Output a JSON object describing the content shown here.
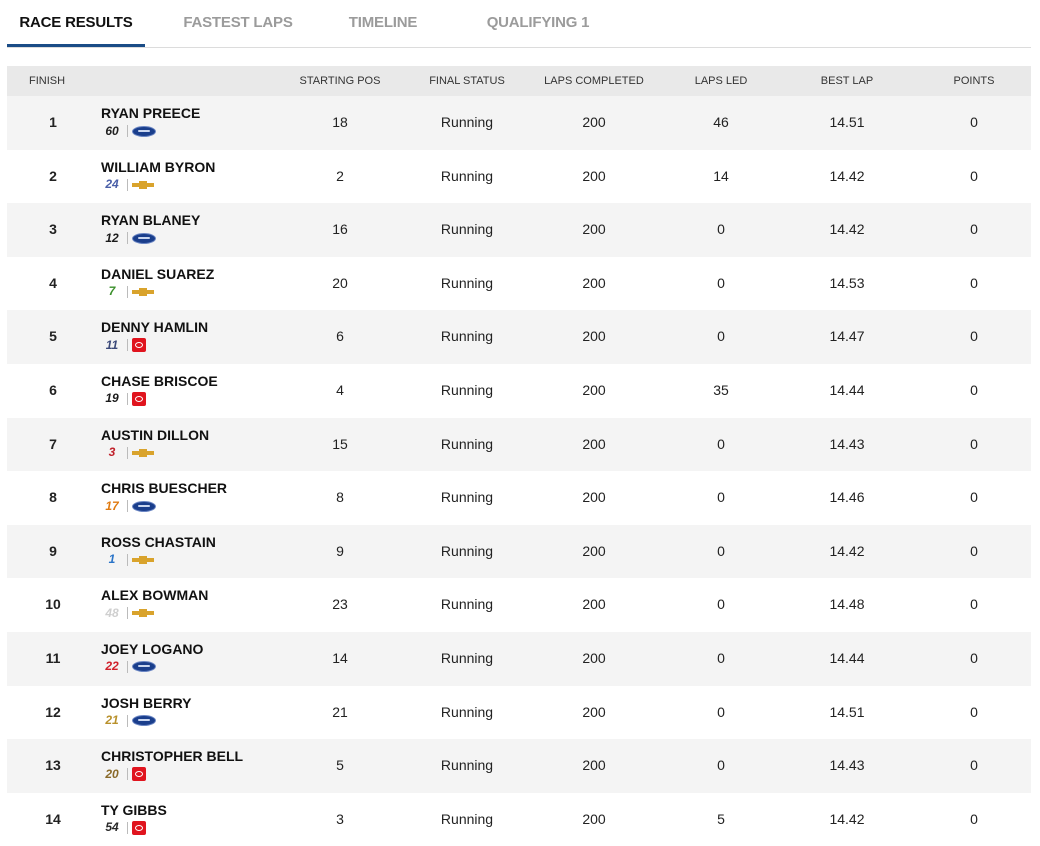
{
  "tabs": [
    {
      "label": "RACE RESULTS",
      "active": true
    },
    {
      "label": "FASTEST LAPS",
      "active": false
    },
    {
      "label": "TIMELINE",
      "active": false
    },
    {
      "label": "QUALIFYING 1",
      "active": false
    }
  ],
  "columns": {
    "finish": "FINISH",
    "starting_pos": "STARTING POS",
    "final_status": "FINAL STATUS",
    "laps_completed": "LAPS COMPLETED",
    "laps_led": "LAPS LED",
    "best_lap": "BEST LAP",
    "points": "POINTS"
  },
  "colors": {
    "accent": "#1a4c86",
    "header_bg": "#e9e9e9",
    "stripe": "#f4f4f4"
  },
  "rows": [
    {
      "finish": "1",
      "driver": "RYAN PREECE",
      "car": "60",
      "car_color": "#222222",
      "make": "ford",
      "start": "18",
      "status": "Running",
      "laps": "200",
      "led": "46",
      "best": "14.51",
      "points": "0"
    },
    {
      "finish": "2",
      "driver": "WILLIAM BYRON",
      "car": "24",
      "car_color": "#4a5fa8",
      "make": "chevy",
      "start": "2",
      "status": "Running",
      "laps": "200",
      "led": "14",
      "best": "14.42",
      "points": "0"
    },
    {
      "finish": "3",
      "driver": "RYAN BLANEY",
      "car": "12",
      "car_color": "#1a1a1a",
      "make": "ford",
      "start": "16",
      "status": "Running",
      "laps": "200",
      "led": "0",
      "best": "14.42",
      "points": "0"
    },
    {
      "finish": "4",
      "driver": "DANIEL SUAREZ",
      "car": "7",
      "car_color": "#3a8f2a",
      "make": "chevy",
      "start": "20",
      "status": "Running",
      "laps": "200",
      "led": "0",
      "best": "14.53",
      "points": "0"
    },
    {
      "finish": "5",
      "driver": "DENNY HAMLIN",
      "car": "11",
      "car_color": "#3c4a7a",
      "make": "toyota",
      "start": "6",
      "status": "Running",
      "laps": "200",
      "led": "0",
      "best": "14.47",
      "points": "0"
    },
    {
      "finish": "6",
      "driver": "CHASE BRISCOE",
      "car": "19",
      "car_color": "#1a1a1a",
      "make": "toyota",
      "start": "4",
      "status": "Running",
      "laps": "200",
      "led": "35",
      "best": "14.44",
      "points": "0"
    },
    {
      "finish": "7",
      "driver": "AUSTIN DILLON",
      "car": "3",
      "car_color": "#c0202a",
      "make": "chevy",
      "start": "15",
      "status": "Running",
      "laps": "200",
      "led": "0",
      "best": "14.43",
      "points": "0"
    },
    {
      "finish": "8",
      "driver": "CHRIS BUESCHER",
      "car": "17",
      "car_color": "#e07a10",
      "make": "ford",
      "start": "8",
      "status": "Running",
      "laps": "200",
      "led": "0",
      "best": "14.46",
      "points": "0"
    },
    {
      "finish": "9",
      "driver": "ROSS CHASTAIN",
      "car": "1",
      "car_color": "#2a74c8",
      "make": "chevy",
      "start": "9",
      "status": "Running",
      "laps": "200",
      "led": "0",
      "best": "14.42",
      "points": "0"
    },
    {
      "finish": "10",
      "driver": "ALEX BOWMAN",
      "car": "48",
      "car_color": "#cfcfcf",
      "make": "chevy",
      "start": "23",
      "status": "Running",
      "laps": "200",
      "led": "0",
      "best": "14.48",
      "points": "0"
    },
    {
      "finish": "11",
      "driver": "JOEY LOGANO",
      "car": "22",
      "car_color": "#d0202a",
      "make": "ford",
      "start": "14",
      "status": "Running",
      "laps": "200",
      "led": "0",
      "best": "14.44",
      "points": "0"
    },
    {
      "finish": "12",
      "driver": "JOSH BERRY",
      "car": "21",
      "car_color": "#b8902a",
      "make": "ford",
      "start": "21",
      "status": "Running",
      "laps": "200",
      "led": "0",
      "best": "14.51",
      "points": "0"
    },
    {
      "finish": "13",
      "driver": "CHRISTOPHER BELL",
      "car": "20",
      "car_color": "#8a6a2a",
      "make": "toyota",
      "start": "5",
      "status": "Running",
      "laps": "200",
      "led": "0",
      "best": "14.43",
      "points": "0"
    },
    {
      "finish": "14",
      "driver": "TY GIBBS",
      "car": "54",
      "car_color": "#2a2a2a",
      "make": "toyota",
      "start": "3",
      "status": "Running",
      "laps": "200",
      "led": "5",
      "best": "14.42",
      "points": "0"
    }
  ]
}
